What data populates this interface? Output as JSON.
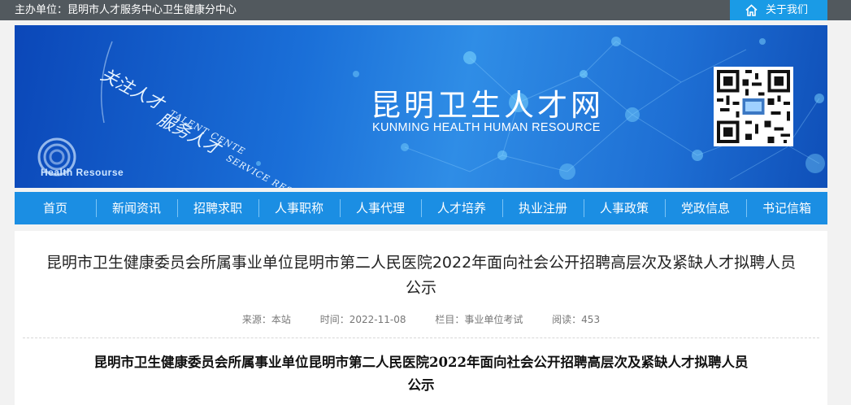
{
  "topbar": {
    "sponsor": "主办单位：昆明市人才服务中心卫生健康分中心",
    "about_label": "关于我们",
    "about_icon": "home-icon"
  },
  "banner": {
    "slogan_line1": "关注人才",
    "slogan_line1_en": "TALENT CENTE",
    "slogan_line2": "服务人才",
    "slogan_line2_en": "SERVICE RESOURCES",
    "logo_text": "Health Resourse",
    "site_title": "昆明卫生人才网",
    "site_subtitle": "KUNMING HEALTH HUMAN RESOURCE"
  },
  "nav": {
    "items": [
      {
        "label": "首页"
      },
      {
        "label": "新闻资讯"
      },
      {
        "label": "招聘求职"
      },
      {
        "label": "人事职称"
      },
      {
        "label": "人事代理"
      },
      {
        "label": "人才培养"
      },
      {
        "label": "执业注册"
      },
      {
        "label": "人事政策"
      },
      {
        "label": "党政信息"
      },
      {
        "label": "书记信箱"
      }
    ]
  },
  "article": {
    "title_line1": "昆明市卫生健康委员会所属事业单位昆明市第二人民医院2022年面向社会公开招聘高层次及紧缺人才拟聘人员",
    "title_line2": "公示",
    "source": "来源：本站",
    "time": "时间：2022-11-08",
    "column": "栏目：事业单位考试",
    "views": "阅读：453",
    "content_title_line1": "昆明市卫生健康委员会所属事业单位昆明市第二人民医院2022年面向社会公开招聘高层次及紧缺人才拟聘人员",
    "content_title_line2": "公示"
  },
  "colors": {
    "topbar": "#52595e",
    "accent": "#1a9be6",
    "nav": "#1b8ee3"
  }
}
